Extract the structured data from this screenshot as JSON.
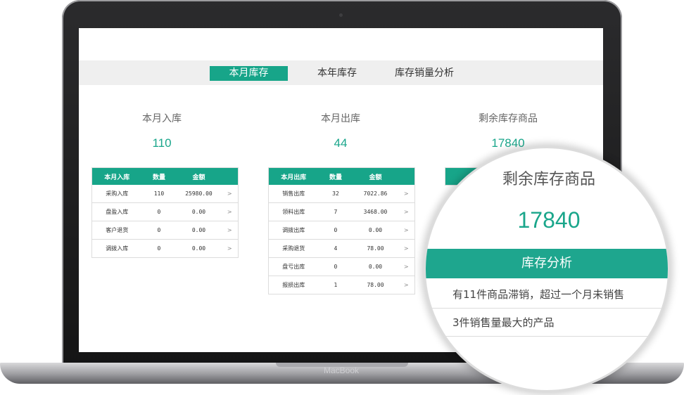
{
  "device": {
    "brand": "MacBook"
  },
  "tabs": [
    {
      "label": "本月库存",
      "active": true
    },
    {
      "label": "本年库存",
      "active": false
    },
    {
      "label": "库存销量分析",
      "active": false
    }
  ],
  "stats": [
    {
      "title": "本月入库",
      "value": "110"
    },
    {
      "title": "本月出库",
      "value": "44"
    },
    {
      "title": "剩余库存商品",
      "value": "17840"
    }
  ],
  "table_in": {
    "headers": [
      "本月入库",
      "数量",
      "金额",
      ""
    ],
    "rows": [
      [
        "采购入库",
        "110",
        "25980.00",
        ">"
      ],
      [
        "盘盈入库",
        "0",
        "0.00",
        ">"
      ],
      [
        "客户退货",
        "0",
        "0.00",
        ">"
      ],
      [
        "调拨入库",
        "0",
        "0.00",
        ">"
      ]
    ]
  },
  "table_out": {
    "headers": [
      "本月出库",
      "数量",
      "金额",
      ""
    ],
    "rows": [
      [
        "销售出库",
        "32",
        "7022.86",
        ">"
      ],
      [
        "领料出库",
        "7",
        "3468.00",
        ">"
      ],
      [
        "调拨出库",
        "0",
        "0.00",
        ">"
      ],
      [
        "采购退货",
        "4",
        "78.00",
        ">"
      ],
      [
        "盘亏出库",
        "0",
        "0.00",
        ">"
      ],
      [
        "报损出库",
        "1",
        "78.00",
        ">"
      ]
    ]
  },
  "magnifier": {
    "title": "剩余库存商品",
    "value": "17840",
    "header": "库存分析",
    "items": [
      "有11件商品滞销，超过一个月未销售",
      "3件销售量最大的产品"
    ]
  },
  "colors": {
    "accent": "#17a589",
    "tabbar_bg": "#efefef"
  }
}
